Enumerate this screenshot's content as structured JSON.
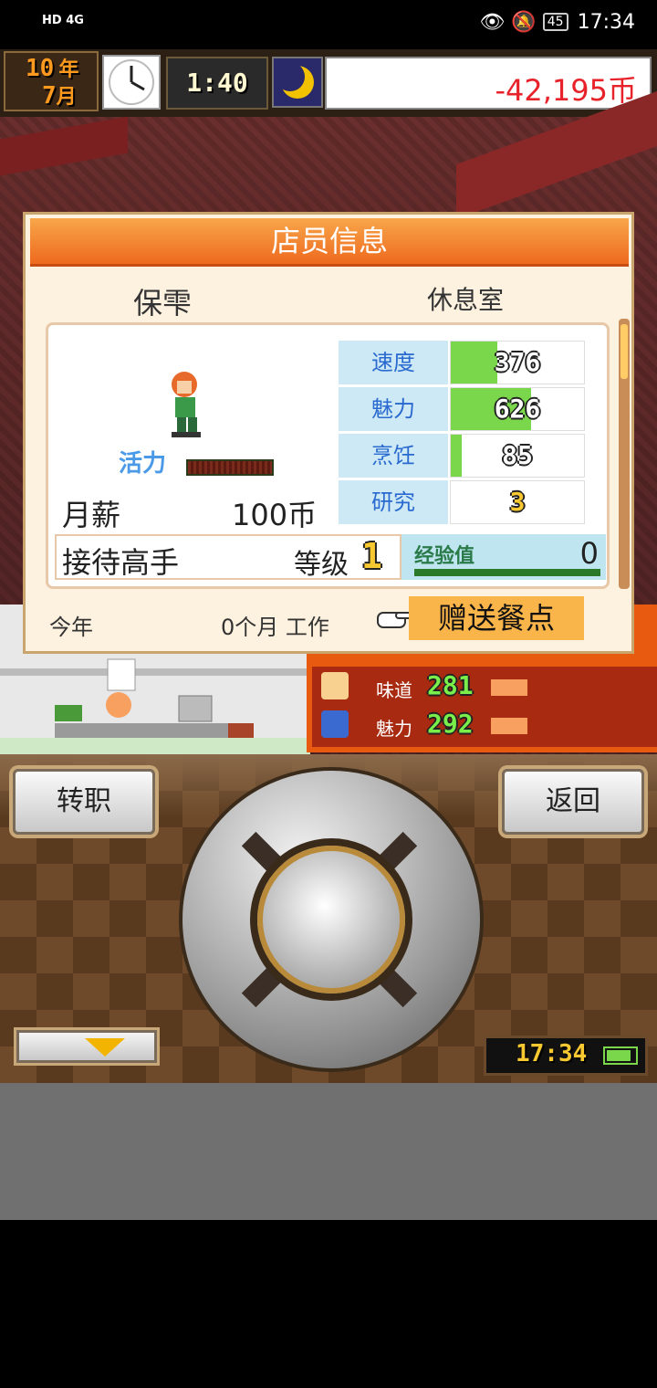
{
  "status_bar": {
    "left": "HD 4G",
    "battery": "45",
    "time": "17:34"
  },
  "game_header": {
    "year": "10",
    "year_unit": "年",
    "month": "7",
    "month_unit": "月",
    "clock_time": "1:40",
    "money": "-42,195币"
  },
  "dialog": {
    "title": "店员信息",
    "name": "保雫",
    "location": "休息室",
    "vigor_label": "活力",
    "stats": [
      {
        "label": "速度",
        "value": "376",
        "fill": 0.35
      },
      {
        "label": "魅力",
        "value": "626",
        "fill": 0.6
      },
      {
        "label": "烹饪",
        "value": "85",
        "fill": 0.08
      },
      {
        "label": "研究",
        "value": "3",
        "fill": 0
      }
    ],
    "salary_label": "月薪",
    "salary_value": "100币",
    "job_title": "接待高手",
    "level_label": "等级",
    "level": "1",
    "exp_label": "经验值",
    "exp_value": "0",
    "year_label": "今年",
    "months_worked": "0个月 工作",
    "gift_button": "赠送餐点"
  },
  "restaurant": {
    "rows": [
      {
        "label": "味道",
        "value": "281"
      },
      {
        "label": "魅力",
        "value": "292"
      }
    ]
  },
  "controls": {
    "left_button": "转职",
    "right_button": "返回",
    "clock": "17:34"
  }
}
